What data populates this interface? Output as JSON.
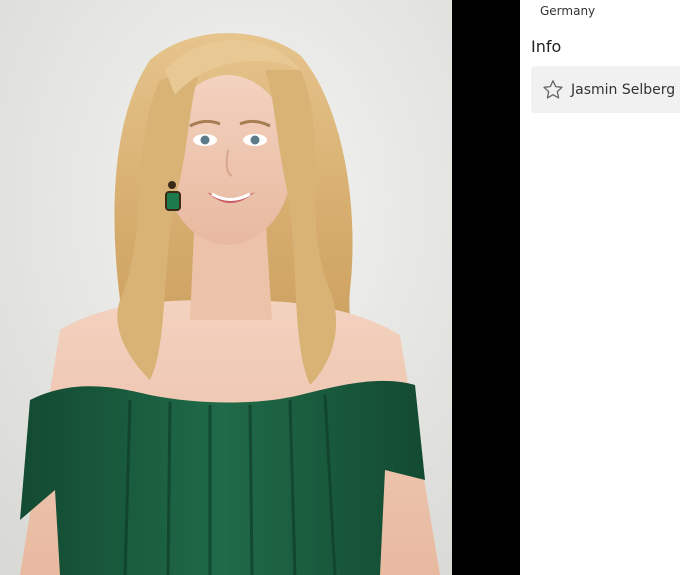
{
  "sidebar": {
    "location": "Germany",
    "section_title": "Info",
    "person": {
      "name": "Jasmin Selberg",
      "icon": "star-outline-icon"
    }
  },
  "photo": {
    "subject": "portrait-photo",
    "background_color": "#e9e9e7",
    "dress_color": "#1f5a3f"
  }
}
